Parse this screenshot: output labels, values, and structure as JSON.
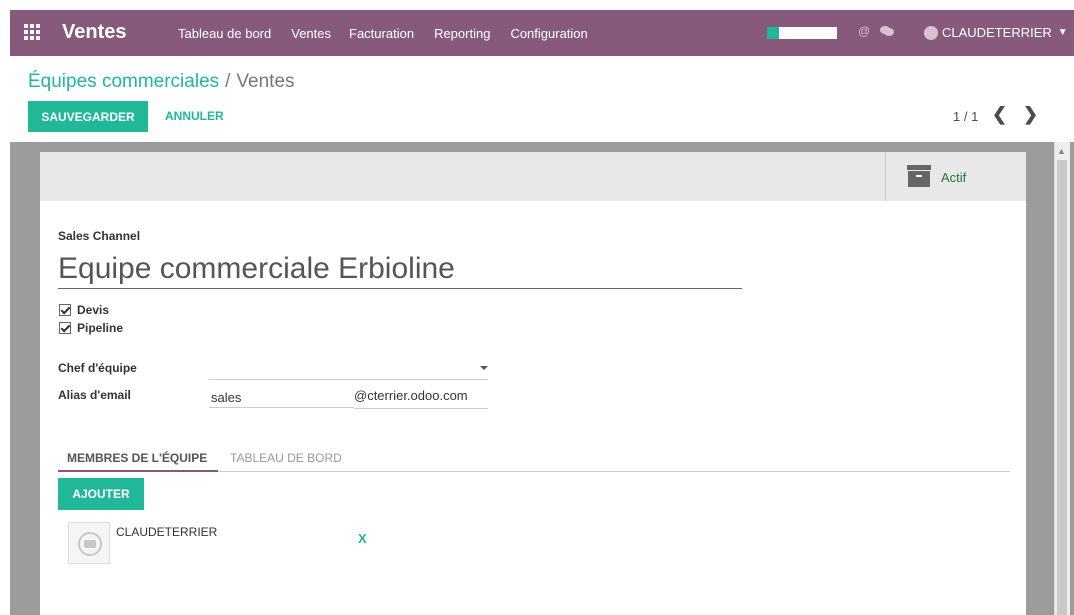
{
  "navbar": {
    "app_name": "Ventes",
    "menu": [
      "Tableau de bord",
      "Ventes",
      "Facturation",
      "Reporting",
      "Configuration"
    ],
    "progress": 0.17,
    "user": "CLAUDETERRIER",
    "at_symbol": "@"
  },
  "breadcrumb": {
    "parent": "Équipes commerciales",
    "separator": "/",
    "current": "Ventes"
  },
  "actions": {
    "save": "SAUVEGARDER",
    "cancel": "ANNULER"
  },
  "pager": {
    "value": "1 / 1",
    "prev": "❮",
    "next": "❯"
  },
  "status_button": {
    "label": "Actif",
    "icon": "archive-icon"
  },
  "form": {
    "channel_label": "Sales Channel",
    "name": "Equipe commerciale Erbioline",
    "checkboxes": [
      {
        "label": "Devis",
        "checked": true
      },
      {
        "label": "Pipeline",
        "checked": true
      }
    ],
    "leader_label": "Chef d'équipe",
    "leader_value": "",
    "alias_label": "Alias d'email",
    "alias_value": "sales",
    "alias_domain": "@cterrier.odoo.com"
  },
  "tabs": [
    "MEMBRES DE L'ÉQUIPE",
    "TABLEAU DE BORD"
  ],
  "members": {
    "add_label": "AJOUTER",
    "items": [
      {
        "name": "CLAUDETERRIER",
        "remove": "X"
      }
    ]
  },
  "colors": {
    "brand": "#875a7b",
    "accent": "#21b799",
    "active_green": "#21763f"
  }
}
